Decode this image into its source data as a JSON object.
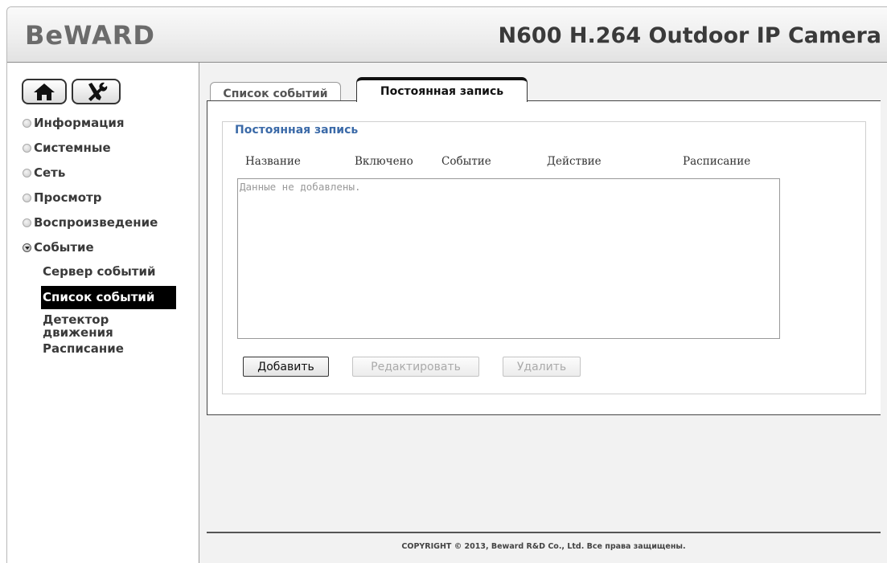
{
  "header": {
    "brand_logo": "BeWARD",
    "device_title": "N600 H.264 Outdoor IP Camera"
  },
  "toolbar": {
    "home_icon": "home-icon",
    "settings_icon": "tools-icon"
  },
  "sidebar": {
    "items": [
      {
        "label": "Информация",
        "expanded": false
      },
      {
        "label": "Системные",
        "expanded": false
      },
      {
        "label": "Сеть",
        "expanded": false
      },
      {
        "label": "Просмотр",
        "expanded": false
      },
      {
        "label": "Воспроизведение",
        "expanded": false
      },
      {
        "label": "Событие",
        "expanded": true
      }
    ],
    "subitems": [
      {
        "label": "Сервер событий",
        "active": false
      },
      {
        "label": "Список событий",
        "active": true
      },
      {
        "label": "Детектор движения",
        "active": false
      },
      {
        "label": "Расписание",
        "active": false
      }
    ]
  },
  "tabs": [
    {
      "label": "Список событий",
      "active": false
    },
    {
      "label": "Постоянная запись",
      "active": true
    }
  ],
  "panel": {
    "legend": "Постоянная запись",
    "columns": [
      "Название",
      "Включено",
      "Событие",
      "Действие",
      "Расписание"
    ],
    "empty_text": "Данные не добавлены."
  },
  "buttons": {
    "add": "Добавить",
    "edit": "Редактировать",
    "delete": "Удалить"
  },
  "footer": {
    "copyright": "COPYRIGHT © 2013, Beward R&D Co., Ltd. Все права защищены."
  },
  "colors": {
    "legend_blue": "#3b6aa8",
    "active_nav_bg": "#000000",
    "watermark": "#f1f1f1"
  }
}
